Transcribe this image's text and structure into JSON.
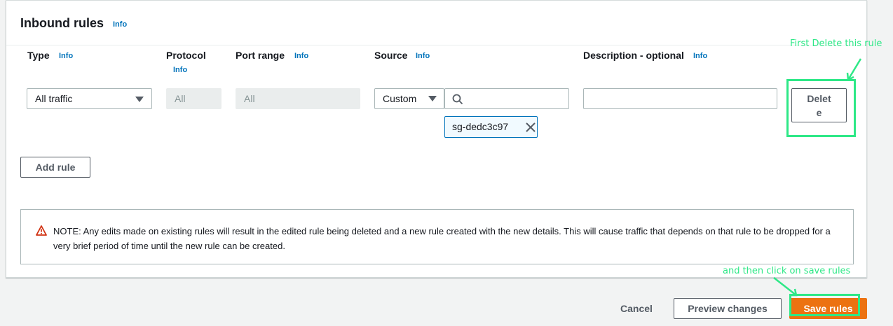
{
  "section": {
    "title": "Inbound rules",
    "info_label": "Info"
  },
  "columns": {
    "type": "Type",
    "protocol": "Protocol",
    "port_range": "Port range",
    "source": "Source",
    "description": "Description - optional"
  },
  "rule": {
    "type_value": "All traffic",
    "protocol_value": "All",
    "port_range_value": "All",
    "source_mode": "Custom",
    "source_search_value": "",
    "source_token": "sg-dedc3c97",
    "description_value": "",
    "delete_label_line1": "Delet",
    "delete_label_line2": "e"
  },
  "add_rule_label": "Add rule",
  "notice": {
    "text": "NOTE: Any edits made on existing rules will result in the edited rule being deleted and a new rule created with the new details. This will cause traffic that depends on that rule to be dropped for a very brief period of time until the new rule can be created."
  },
  "footer": {
    "cancel_label": "Cancel",
    "preview_label": "Preview changes",
    "save_label": "Save rules"
  },
  "annotations": {
    "delete_note": "First Delete this rule",
    "save_note": "and then click on save rules",
    "color": "#2ee887"
  },
  "colors": {
    "primary_button": "#ec7211",
    "info_link": "#0073bb",
    "warning_icon": "#d13212"
  },
  "icons": {
    "dropdown": "caret-down-icon",
    "search": "search-icon",
    "remove_token": "close-icon",
    "warning": "warning-icon"
  }
}
